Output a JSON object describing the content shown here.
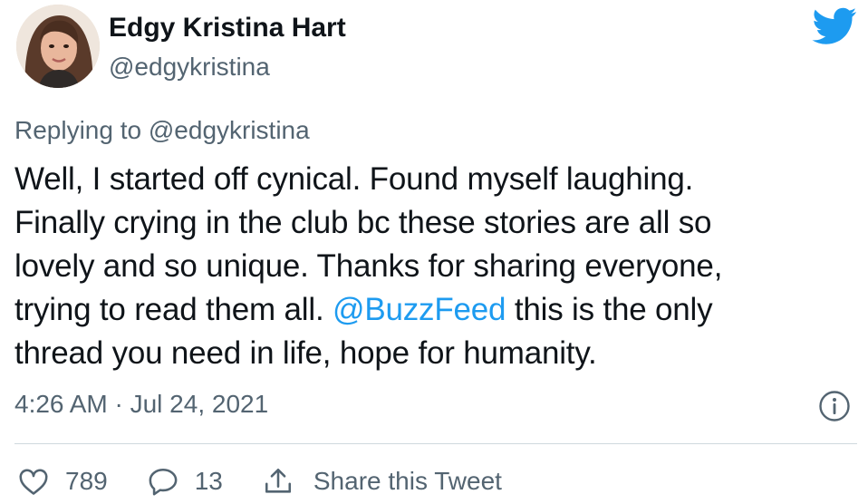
{
  "author": {
    "display_name": "Edgy Kristina Hart",
    "handle": "@edgykristina"
  },
  "tweet": {
    "replying_prefix": "Replying to ",
    "replying_to": "@edgykristina",
    "lines": [
      "Well, I started off cynical. Found myself laughing.",
      "Finally crying in the club bc these stories are all so",
      "lovely and so unique. Thanks for sharing everyone,"
    ],
    "line4_before": "trying to read them all. ",
    "line4_mention": "@BuzzFeed",
    "line4_after": " this is the only",
    "line5": "thread you need in life, hope for humanity.",
    "timestamp": "4:26 AM · Jul 24, 2021"
  },
  "actions": {
    "likes": "789",
    "replies": "13",
    "share_label": "Share this Tweet"
  },
  "icons": {
    "brand": "twitter-bird-icon",
    "info": "info-icon",
    "like": "heart-icon",
    "reply": "speech-bubble-icon",
    "share": "share-icon"
  },
  "colors": {
    "brand_blue": "#1d9bf0",
    "secondary_text": "#536471",
    "primary_text": "#0f1419",
    "divider": "#cfd9de"
  }
}
